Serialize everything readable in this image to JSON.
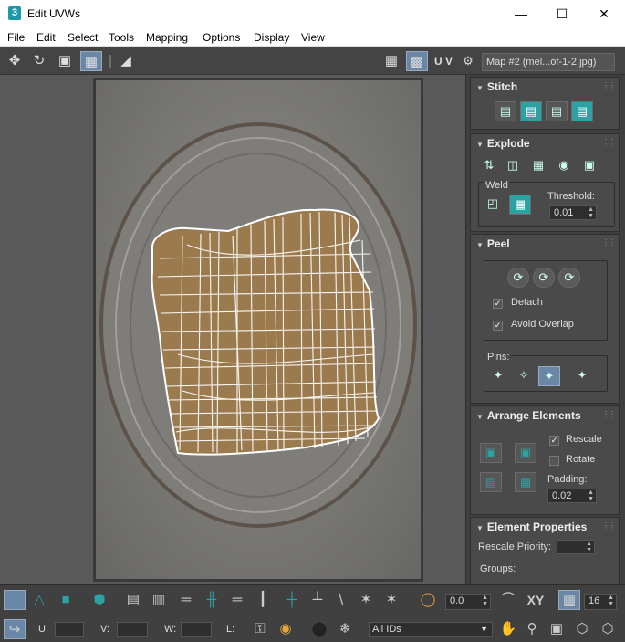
{
  "window": {
    "app_icon": "3",
    "title": "Edit UVWs",
    "minimize": "—",
    "maximize": "☐",
    "close": "✕"
  },
  "menu": [
    "File",
    "Edit",
    "Select",
    "Tools",
    "Mapping",
    "Options",
    "Display",
    "View"
  ],
  "toolbar": {
    "uv_label": "U V",
    "map_selector": "Map #2 (mel...of-1-2.jpg)"
  },
  "panel": {
    "stitch": {
      "title": "Stitch"
    },
    "explode": {
      "title": "Explode",
      "weld_label": "Weld",
      "threshold_label": "Threshold:",
      "threshold_value": "0.01"
    },
    "peel": {
      "title": "Peel",
      "detach": "Detach",
      "avoid_overlap": "Avoid Overlap",
      "pins_label": "Pins:"
    },
    "arrange": {
      "title": "Arrange Elements",
      "rescale": "Rescale",
      "rotate": "Rotate",
      "padding_label": "Padding:",
      "padding_value": "0.02"
    },
    "element_props": {
      "title": "Element Properties",
      "rescale_priority": "Rescale Priority:",
      "groups": "Groups:"
    }
  },
  "bottom": {
    "rotate_value": "0.0",
    "xy_label": "XY",
    "grid_value": "16",
    "u_label": "U:",
    "v_label": "V:",
    "w_label": "W:",
    "l_label": "L:",
    "ids_select": "All IDs"
  },
  "colors": {
    "accent": "#2ba3a5",
    "highlight": "#6b87a8",
    "wire": "#ffffff",
    "toast": "#9b7a4e"
  }
}
